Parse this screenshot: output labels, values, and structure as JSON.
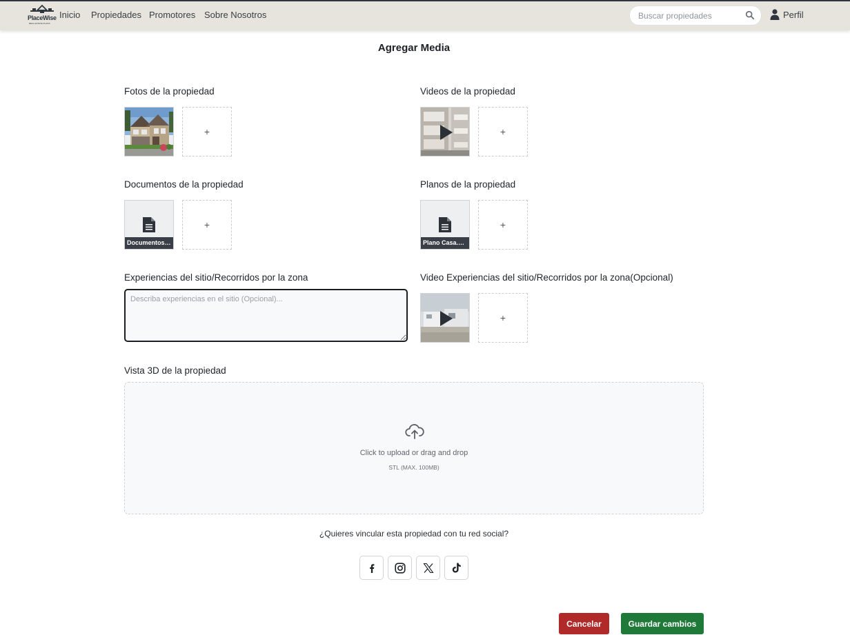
{
  "nav": {
    "logo_text": "PlaceWise",
    "logo_sub": "REAL ESTATE PLANS",
    "links": [
      "Inicio",
      "Propiedades",
      "Promotores",
      "Sobre Nosotros"
    ],
    "search_placeholder": "Buscar propiedades",
    "profile_label": "Perfil"
  },
  "page_title": "Agregar Media",
  "sections": {
    "photos": {
      "label": "Fotos de la propiedad",
      "add": "+"
    },
    "videos": {
      "label": "Videos de la propiedad",
      "add": "+"
    },
    "documents": {
      "label": "Documentos de la propiedad",
      "file_name": "Documentos ...",
      "add": "+"
    },
    "plans": {
      "label": "Planos de la propiedad",
      "file_name": "Plano Casa.pdf",
      "add": "+"
    },
    "experiences": {
      "label": "Experiencias del sitio/Recorridos por la zona",
      "placeholder": "Describa experiencias en el sitio (Opcional)..."
    },
    "experience_videos": {
      "label": "Video Experiencias del sitio/Recorridos por la zona(Opcional)",
      "add": "+"
    },
    "view3d": {
      "label": "Vista 3D de la propiedad",
      "upload_text": "Click to upload or drag and drop",
      "upload_hint": "STL (MAX. 100MB)"
    }
  },
  "social": {
    "question": "¿Quieres vincular esta propiedad con tu red social?",
    "networks": [
      "facebook-icon",
      "instagram-icon",
      "x-icon",
      "tiktok-icon"
    ]
  },
  "actions": {
    "cancel": "Cancelar",
    "save": "Guardar cambios"
  },
  "colors": {
    "navbar": "#e6e4dd",
    "cancel": "#b02a2a",
    "save": "#1f7a3a"
  }
}
